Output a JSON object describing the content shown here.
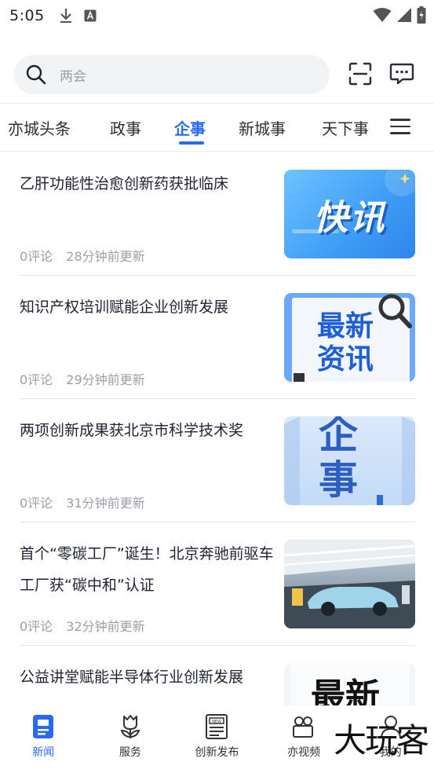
{
  "status": {
    "time": "5:05"
  },
  "search": {
    "placeholder": "两会"
  },
  "tabs": [
    {
      "label": "亦城头条",
      "active": false
    },
    {
      "label": "政事",
      "active": false
    },
    {
      "label": "企事",
      "active": true
    },
    {
      "label": "新城事",
      "active": false
    },
    {
      "label": "天下事",
      "active": false
    }
  ],
  "news": [
    {
      "title": "乙肝功能性治愈创新药获批临床",
      "comments": "0评论",
      "time": "28分钟前更新",
      "thumb_text": "快讯"
    },
    {
      "title": "知识产权培训赋能企业创新发展",
      "comments": "0评论",
      "time": "29分钟前更新",
      "thumb_text_1": "最新",
      "thumb_text_2": "资讯"
    },
    {
      "title": "两项创新成果获北京市科学技术奖",
      "comments": "0评论",
      "time": "31分钟前更新",
      "thumb_text_1": "企",
      "thumb_text_2": "事"
    },
    {
      "title": "首个“零碳工厂”诞生！北京奔驰前驱车工厂获“碳中和”认证",
      "comments": "0评论",
      "time": "32分钟前更新"
    },
    {
      "title": "公益讲堂赋能半导体行业创新发展",
      "thumb_text": "最新"
    }
  ],
  "bottom_nav": [
    {
      "label": "新闻",
      "icon": "news-icon",
      "active": true
    },
    {
      "label": "服务",
      "icon": "tulip-icon",
      "active": false
    },
    {
      "label": "创新发布",
      "icon": "newspaper-icon",
      "active": false
    },
    {
      "label": "亦视频",
      "icon": "camera-icon",
      "active": false
    },
    {
      "label": "我的",
      "icon": "user-icon",
      "active": false
    }
  ],
  "watermark": "大玩客",
  "colors": {
    "accent": "#2a6af0",
    "text": "#1e2233",
    "meta": "#9a9ea6"
  }
}
